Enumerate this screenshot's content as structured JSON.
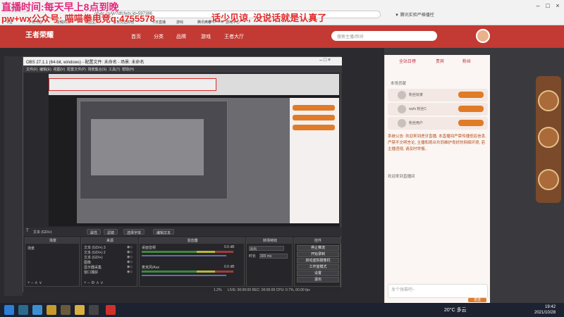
{
  "overlay": {
    "line1": "直播时间:每天早上8点到晚",
    "line2": "pw+wx公众号: 喵喵拳电竞q:4755578",
    "line3": "话少见谅, 没说话就是认真了"
  },
  "browser": {
    "tabs": [
      "王者荣耀...",
      "",
      "",
      ""
    ],
    "address": "...gfsdc.cn/yl/?dfcfwts:id=597386",
    "address_right": "▼ 腾讯实验严格播控",
    "bookmarks": [
      "书签",
      "手机书签",
      "豪威商城",
      "精品宝贝",
      "好货优选购物",
      "今日直播",
      "游戏",
      "腾讯点卷",
      "游戏中心"
    ],
    "search_hint": "ai ging kong"
  },
  "site": {
    "logo": "王者荣耀",
    "nav": [
      "首页",
      "分类",
      "品牌",
      "游戏",
      "王者大厅",
      "",
      ""
    ],
    "search_placeholder": "搜索主播/房间"
  },
  "obs": {
    "title": "OBS 27.1.1 (64-bit, windows) - 配置文件: 未命名 - 场景: 未命名",
    "menu": [
      "文件(F)",
      "编辑(E)",
      "视图(V)",
      "配置文件(P)",
      "场景集合(S)",
      "工具(T)",
      "帮助(H)"
    ],
    "toolbar": {
      "source_label": "文本 (GDI+)",
      "properties": "属性",
      "filters": "滤镜",
      "select_text": "选择字体",
      "edit_text": "编辑文本"
    },
    "panels": {
      "scenes": "场景",
      "sources": "来源",
      "mixer": "混音器",
      "transitions": "转场特效",
      "controls": "控件"
    },
    "scenes_list": [
      "场景"
    ],
    "sources_list": [
      "文本 (GDI+) 3",
      "文本 (GDI+) 2",
      "文本 (GDI+)",
      "图像",
      "显示器采集",
      "窗口捕获"
    ],
    "mixer": {
      "track1": "桌面音频",
      "track1_db": "0.0 dB",
      "track2": "麦克风/Aux",
      "track2_db": "0.0 dB"
    },
    "transition": {
      "type": "淡出",
      "duration_label": "时长",
      "duration_value": "300 ms"
    },
    "controls": [
      "停止推流",
      "开始录制",
      "启动虚拟摄像机",
      "工作室模式",
      "设置",
      "退出"
    ],
    "status": "LIVE: 00:00:00   REC: 00:00:00   CPU: 0.7%, 60.00 fps",
    "dropped": "1.2%"
  },
  "chat": {
    "tabs": [
      "全站日榜",
      "贵宾",
      "粉丝"
    ],
    "rank_label": "本场贡献",
    "ranks": [
      {
        "name": "粉丝玩家"
      },
      {
        "name": "wyfs 粉丝C"
      },
      {
        "name": "粉丝用户"
      }
    ],
    "text": "系统公告: 欢迎来到虎牙直播, 本直播间严禁传播低俗信息, 严禁不文明言论, 主播和观众共同维护良好的网络环境, 若主播违规, 请及时举报。",
    "notice": "欢迎来到直播间",
    "input_placeholder": "发个弹幕吧~",
    "send": "发送"
  },
  "taskbar": {
    "weather": "20°C 多云",
    "time": "19:42",
    "date": "2021/10/28"
  },
  "colors": {
    "site_red": "#c23a33",
    "overlay_pink": "#e0287a",
    "overlay_red": "#e02828",
    "obs_dark": "#2a2a2e"
  }
}
